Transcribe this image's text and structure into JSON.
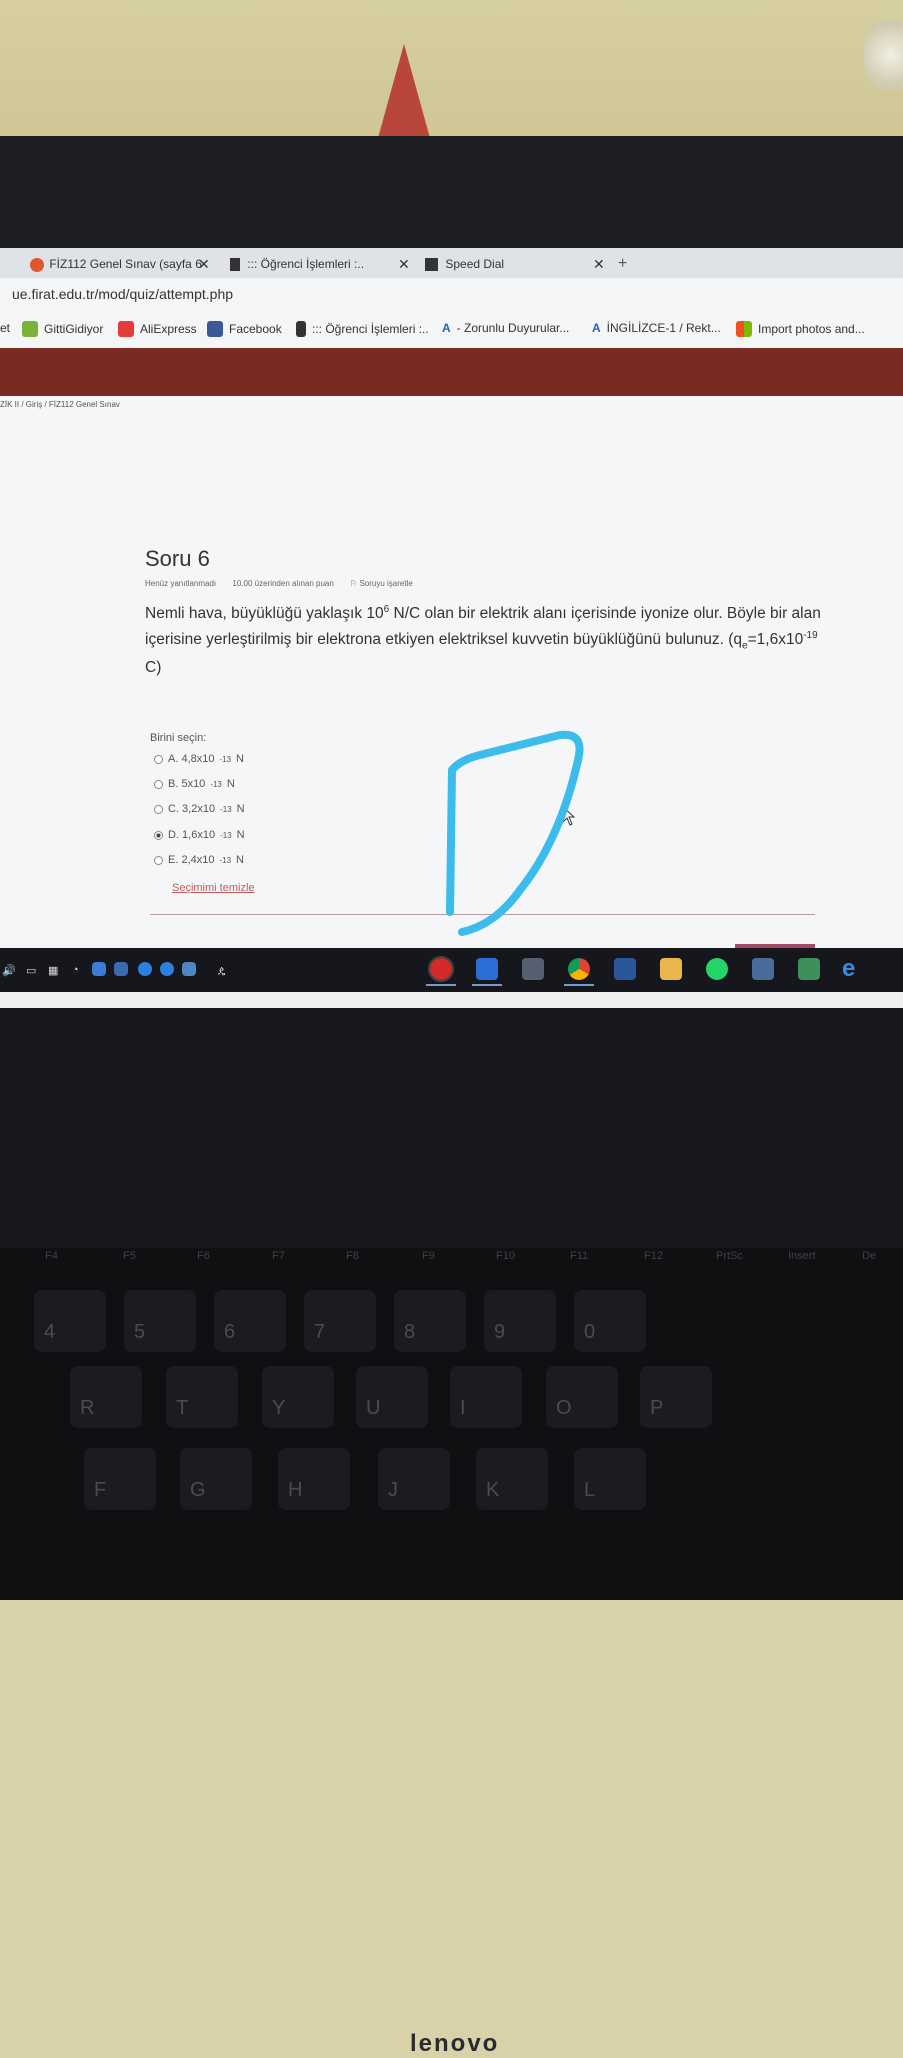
{
  "browser": {
    "tabs": [
      {
        "label": "FİZ112 Genel Sınav (sayfa 6"
      },
      {
        "label": "::: Öğrenci İşlemleri :.."
      },
      {
        "label": "Speed Dial"
      }
    ],
    "url": "ue.firat.edu.tr/mod/quiz/attempt.php",
    "bookmarks": [
      {
        "label": "et"
      },
      {
        "label": "GittiGidiyor"
      },
      {
        "label": "AliExpress"
      },
      {
        "label": "Facebook"
      },
      {
        "label": "::: Öğrenci İşlemleri :.."
      },
      {
        "label": "- Zorunlu Duyurular..."
      },
      {
        "label": "İNGİLİZCE-1 / Rekt..."
      },
      {
        "label": "Import photos and..."
      }
    ]
  },
  "page": {
    "breadcrumb": "ZİK II  /  Giriş  /  FİZ112 Genel Sınav",
    "question_title": "Soru 6",
    "meta": {
      "status": "Henüz yanıtlanmadı",
      "points": "10.00 üzerinden alınan puan",
      "flag": "Soruyu işaretle"
    },
    "question_part1": "Nemli hava, büyüklüğü yaklaşık 10",
    "question_sup1": "6",
    "question_part2": " N/C olan bir elektrik alanı içerisinde iyonize olur. Böyle bir alan içerisine yerleştirilmiş bir elektrona etkiyen elektriksel kuvvetin büyüklüğünü bulunuz. (q",
    "question_sub": "e",
    "question_part3": "=1,6x10",
    "question_sup2": "-19",
    "question_part4": " C)",
    "choose_label": "Birini seçin:",
    "options": [
      {
        "prefix": "A. 4,8x10",
        "exp": "-13",
        "suffix": " N",
        "selected": false
      },
      {
        "prefix": "B. 5x10",
        "exp": "-13",
        "suffix": " N",
        "selected": false
      },
      {
        "prefix": "C. 3,2x10",
        "exp": "-13",
        "suffix": " N",
        "selected": false
      },
      {
        "prefix": "D. 1,6x10",
        "exp": "-13",
        "suffix": "N",
        "selected": true
      },
      {
        "prefix": "E. 2,4x10",
        "exp": "-13",
        "suffix": " N",
        "selected": false
      }
    ],
    "clear_label": "Seçimimi temizle"
  },
  "laptop": {
    "brand": "lenovo",
    "function_keys": [
      "F4",
      "F5",
      "F6",
      "F7",
      "F8",
      "F9",
      "F10",
      "F11",
      "F12",
      "PrtSc",
      "Insert",
      "De"
    ],
    "number_keys": [
      "4",
      "5",
      "6",
      "7",
      "8",
      "9",
      "0"
    ],
    "letter_keys_row1": [
      "R",
      "T",
      "Y",
      "U",
      "I",
      "O",
      "P"
    ],
    "letter_keys_row2": [
      "F",
      "G",
      "H",
      "J",
      "K",
      "L"
    ]
  },
  "colors": {
    "annotation": "#3bbcea",
    "site_header": "#7a2a23",
    "clear_link": "#c45b5b"
  },
  "annotation": {
    "letter": "D"
  }
}
